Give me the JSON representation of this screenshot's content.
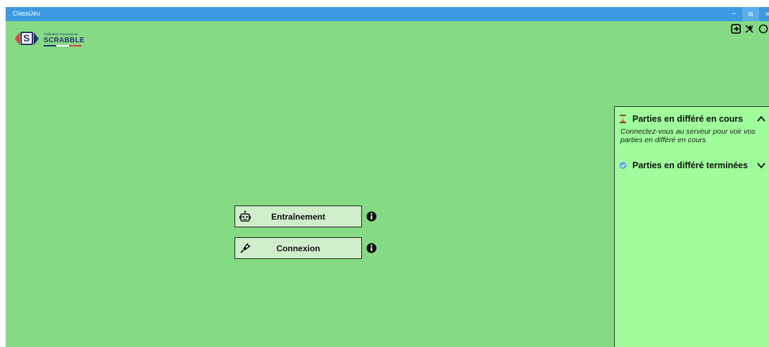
{
  "window": {
    "title": "ClassiJeu",
    "controls": {
      "minimize": "–",
      "restore": "⧉",
      "close": "✕"
    }
  },
  "logo": {
    "letter": "S",
    "line1": "Fédération Française de",
    "line2": "SCRABBLE",
    "colors": {
      "blue": "#25356b",
      "red": "#e63946"
    }
  },
  "toolbar_icons": [
    "exit-icon",
    "plug-off-icon",
    "help-icon"
  ],
  "main": {
    "training_label": "Entraînement",
    "connect_label": "Connexion"
  },
  "side_panel": {
    "pending": {
      "title": "Parties en différé en cours",
      "text": "Connectez-vous au serveur pour voir vos parties en différé en cours",
      "expanded": true
    },
    "finished": {
      "title": "Parties en différé terminées",
      "expanded": false
    }
  },
  "colors": {
    "background": "#85da84",
    "titlebar": "#3d9ae2",
    "panel": "#9ffe9b",
    "button": "#cfefcb"
  }
}
